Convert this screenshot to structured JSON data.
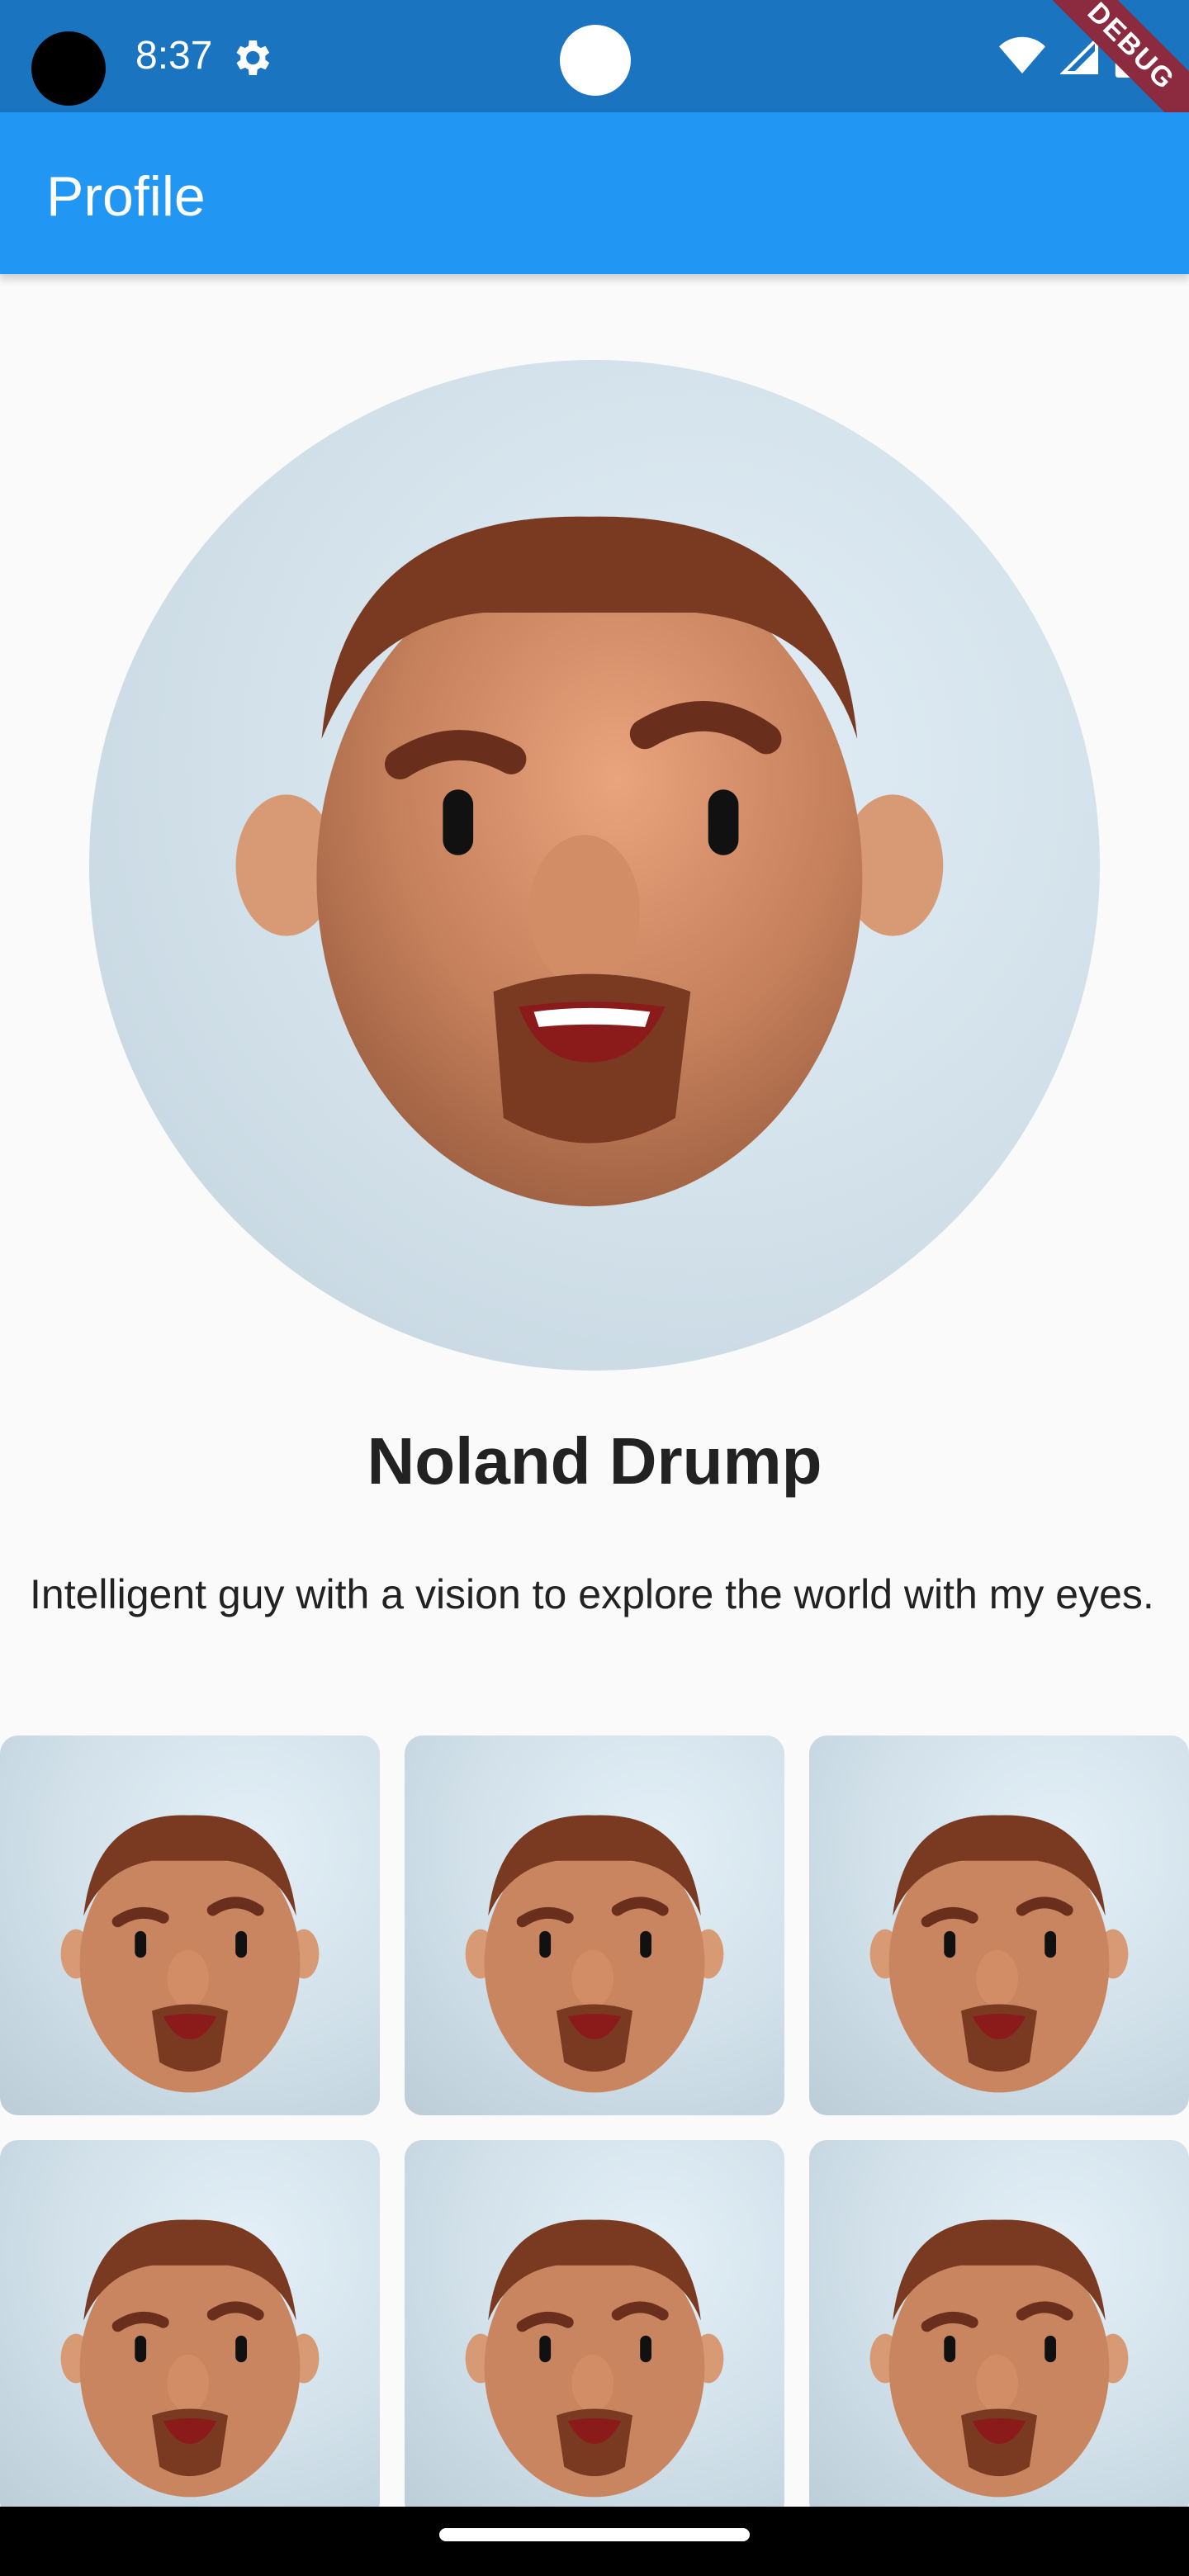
{
  "status_bar": {
    "time": "8:37",
    "debug_label": "DEBUG",
    "icons": [
      "settings-gear-icon",
      "wifi-icon",
      "cell-signal-icon",
      "battery-icon"
    ]
  },
  "app_bar": {
    "title": "Profile"
  },
  "profile": {
    "name": "Noland Drump",
    "bio": "Intelligent guy with a vision to explore the world with my eyes."
  },
  "gallery": {
    "items": [
      {
        "label": "avatar-1"
      },
      {
        "label": "avatar-2"
      },
      {
        "label": "avatar-3"
      },
      {
        "label": "avatar-4"
      },
      {
        "label": "avatar-5"
      },
      {
        "label": "avatar-6"
      }
    ]
  },
  "colors": {
    "status_bar": "#1a74bf",
    "app_bar": "#2196f3",
    "background": "#fafafa"
  }
}
